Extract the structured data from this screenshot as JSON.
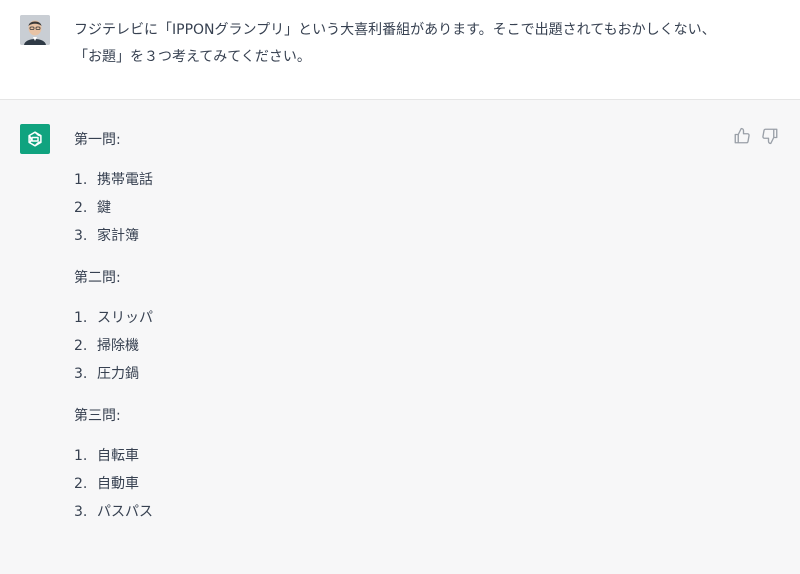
{
  "user_message": {
    "avatar_icon": "user-photo-avatar",
    "text": "フジテレビに「IPPONグランプリ」という大喜利番組があります。そこで出題されてもおかしくない、「お題」を３つ考えてみてください。"
  },
  "assistant_message": {
    "avatar_icon": "chatgpt-logo-icon",
    "avatar_color": "#10a37f",
    "sections": [
      {
        "title": "第一問:",
        "items": [
          {
            "num": "1.",
            "text": "携帯電話"
          },
          {
            "num": "2.",
            "text": "鍵"
          },
          {
            "num": "3.",
            "text": "家計簿"
          }
        ]
      },
      {
        "title": "第二問:",
        "items": [
          {
            "num": "1.",
            "text": "スリッパ"
          },
          {
            "num": "2.",
            "text": "掃除機"
          },
          {
            "num": "3.",
            "text": "圧力鍋"
          }
        ]
      },
      {
        "title": "第三問:",
        "items": [
          {
            "num": "1.",
            "text": "自転車"
          },
          {
            "num": "2.",
            "text": "自動車"
          },
          {
            "num": "3.",
            "text": "パスパス"
          }
        ]
      }
    ],
    "feedback_icons": [
      "thumbs-up-icon",
      "thumbs-down-icon"
    ]
  }
}
